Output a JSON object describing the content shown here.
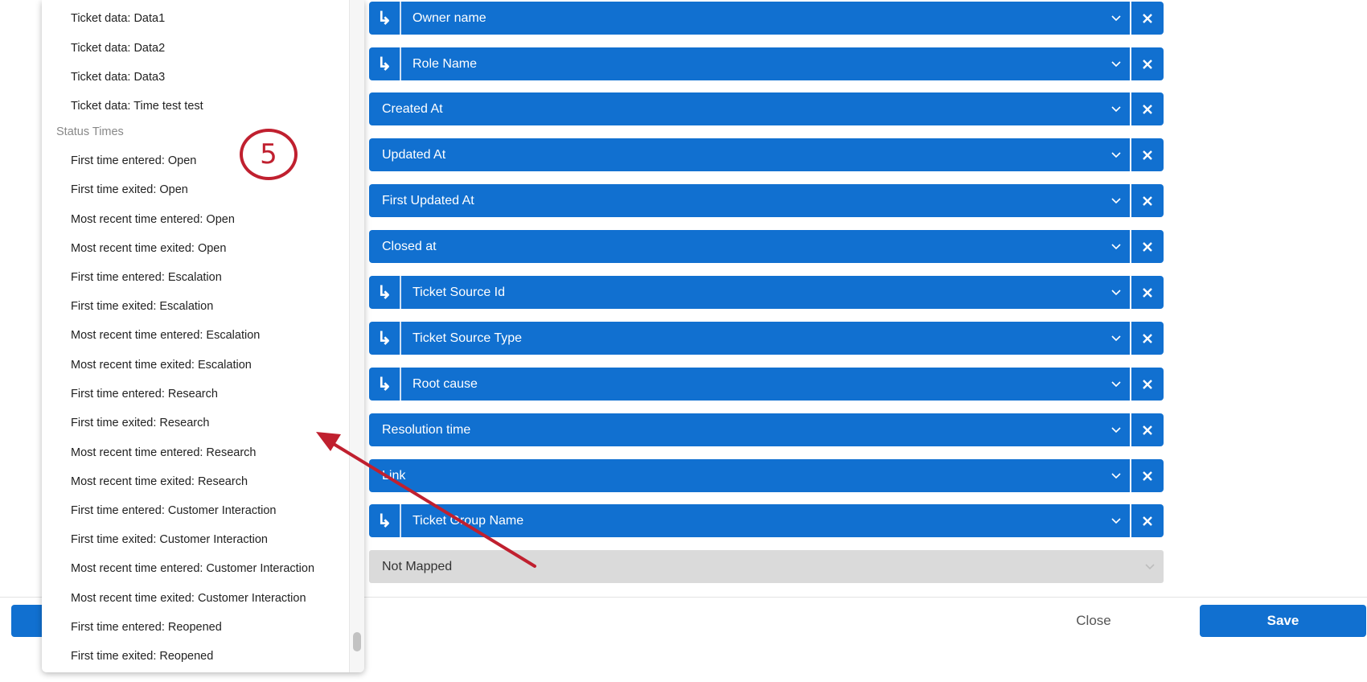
{
  "dropdown": {
    "items_top": [
      "Ticket data: Data1",
      "Ticket data: Data2",
      "Ticket data: Data3",
      "Ticket data: Time test test"
    ],
    "group_label": "Status Times",
    "items": [
      "First time entered: Open",
      "First time exited: Open",
      "Most recent time entered: Open",
      "Most recent time exited: Open",
      "First time entered: Escalation",
      "First time exited: Escalation",
      "Most recent time entered: Escalation",
      "Most recent time exited: Escalation",
      "First time entered: Research",
      "First time exited: Research",
      "Most recent time entered: Research",
      "Most recent time exited: Research",
      "First time entered: Customer Interaction",
      "First time exited: Customer Interaction",
      "Most recent time entered: Customer Interaction",
      "Most recent time exited: Customer Interaction",
      "First time entered: Reopened",
      "First time exited: Reopened"
    ]
  },
  "mappings": [
    {
      "label": "Owner name",
      "nested": true
    },
    {
      "label": "Role Name",
      "nested": true
    },
    {
      "label": "Created At",
      "nested": false
    },
    {
      "label": "Updated At",
      "nested": false
    },
    {
      "label": "First Updated At",
      "nested": false
    },
    {
      "label": "Closed at",
      "nested": false
    },
    {
      "label": "Ticket Source Id",
      "nested": true
    },
    {
      "label": "Ticket Source Type",
      "nested": true
    },
    {
      "label": "Root cause",
      "nested": true
    },
    {
      "label": "Resolution time",
      "nested": false
    },
    {
      "label": "Link",
      "nested": false
    },
    {
      "label": "Ticket Group Name",
      "nested": true
    }
  ],
  "unmapped_label": "Not Mapped",
  "footer": {
    "close_label": "Close",
    "save_label": "Save"
  },
  "annotation": {
    "step_number": "5"
  },
  "colors": {
    "primary": "#1170d0",
    "annotation": "#c0202f",
    "unmapped": "#dadada"
  },
  "icons": {
    "nested": "subdirectory-arrow-icon",
    "dropdown": "chevron-down-icon",
    "remove": "close-icon"
  }
}
